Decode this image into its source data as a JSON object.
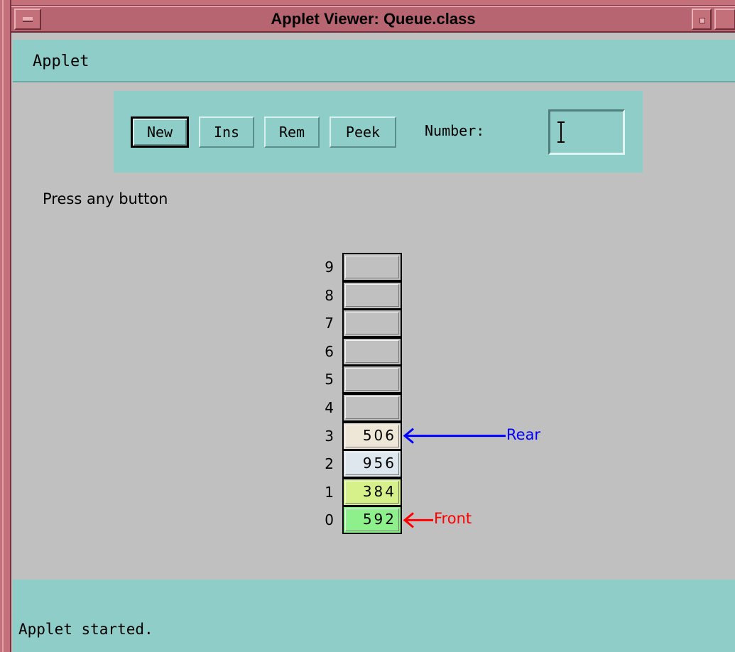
{
  "window": {
    "title": "Applet Viewer: Queue.class",
    "frame_color": "#b76570"
  },
  "menubar": {
    "items": [
      "Applet"
    ]
  },
  "controls": {
    "buttons": [
      "New",
      "Ins",
      "Rem",
      "Peek"
    ],
    "number_label": "Number:",
    "number_value": "",
    "panel_color": "#8ecdc8"
  },
  "message": "Press any button",
  "queue": {
    "indices": [
      "9",
      "8",
      "7",
      "6",
      "5",
      "4",
      "3",
      "2",
      "1",
      "0"
    ],
    "cells": [
      {
        "index": "9",
        "value": "",
        "color": "#c0c0c0"
      },
      {
        "index": "8",
        "value": "",
        "color": "#c0c0c0"
      },
      {
        "index": "7",
        "value": "",
        "color": "#c0c0c0"
      },
      {
        "index": "6",
        "value": "",
        "color": "#c0c0c0"
      },
      {
        "index": "5",
        "value": "",
        "color": "#c0c0c0"
      },
      {
        "index": "4",
        "value": "",
        "color": "#c0c0c0"
      },
      {
        "index": "3",
        "value": "506",
        "color": "#eee6d6"
      },
      {
        "index": "2",
        "value": "956",
        "color": "#dee6ee"
      },
      {
        "index": "1",
        "value": "384",
        "color": "#d6f08a"
      },
      {
        "index": "0",
        "value": "592",
        "color": "#8ef08a"
      }
    ],
    "rear_label": "Rear",
    "rear_index": "3",
    "rear_color": "#0000ff",
    "front_label": "Front",
    "front_index": "0",
    "front_color": "#ff0000"
  },
  "status": "Applet started."
}
